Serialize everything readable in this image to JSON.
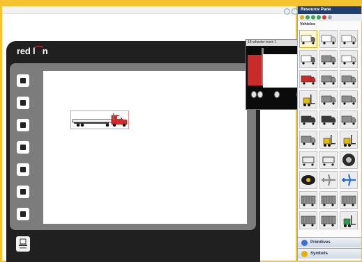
{
  "device": {
    "brand_left": "red l",
    "brand_right": "n"
  },
  "popup": {
    "title": "18-wheeler truck 1"
  },
  "resource_pane": {
    "title": "Resource Pane",
    "category": "Vehicles",
    "sections": [
      "Primitives",
      "Symbols"
    ]
  },
  "tiles": [
    {
      "kind": "semi-truck-white",
      "selected": true
    },
    {
      "kind": "box-truck-white"
    },
    {
      "kind": "box-truck-white"
    },
    {
      "kind": "semi-truck-white"
    },
    {
      "kind": "box-truck-gray"
    },
    {
      "kind": "box-truck-white"
    },
    {
      "kind": "truck-red"
    },
    {
      "kind": "truck-gray"
    },
    {
      "kind": "truck-gray"
    },
    {
      "kind": "forklift-yellow"
    },
    {
      "kind": "tank-truck-gray"
    },
    {
      "kind": "pickup-gray"
    },
    {
      "kind": "dump-truck-dark"
    },
    {
      "kind": "truck-dark"
    },
    {
      "kind": "box-truck-gray"
    },
    {
      "kind": "truck-gray"
    },
    {
      "kind": "forklift-yellow"
    },
    {
      "kind": "forklift-yellow"
    },
    {
      "kind": "cart-gray"
    },
    {
      "kind": "trolley-gray"
    },
    {
      "kind": "wheel-dark"
    },
    {
      "kind": "tire-dark"
    },
    {
      "kind": "airplane-gray"
    },
    {
      "kind": "airplane-blue"
    },
    {
      "kind": "railcar-gray"
    },
    {
      "kind": "railcar-gray"
    },
    {
      "kind": "railcar-gray"
    },
    {
      "kind": "railcar-gray"
    },
    {
      "kind": "railcar-gray"
    },
    {
      "kind": "forklift-green"
    }
  ],
  "colors": {
    "frame": "#f4c430",
    "brand_accent": "#d21f1f",
    "truck_cab": "#d42a2a",
    "pane_title": "#1f3f73"
  }
}
